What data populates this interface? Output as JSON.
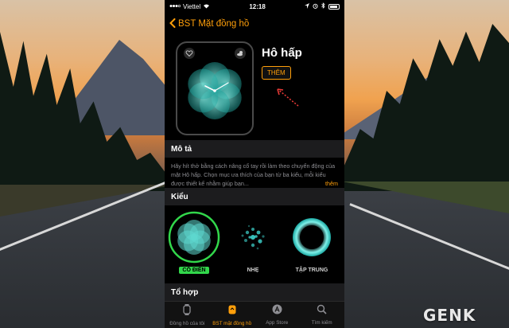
{
  "status": {
    "carrier": "Viettel",
    "time": "12:18"
  },
  "nav": {
    "back_label": "BST Mặt đồng hồ"
  },
  "face": {
    "title": "Hô hấp",
    "add_label": "THÊM"
  },
  "description": {
    "heading": "Mô tả",
    "text": "Hãy hít thở bằng cách nâng cổ tay rồi làm theo chuyển động của mặt Hô hấp. Chọn mục ưa thích của bạn từ ba kiểu, mỗi kiểu được thiết kế nhằm giúp bạn...",
    "more_label": "thêm"
  },
  "styles": {
    "heading": "Kiểu",
    "options": [
      {
        "label": "CỔ ĐIỂN",
        "selected": true
      },
      {
        "label": "NHẸ",
        "selected": false
      },
      {
        "label": "TẬP TRUNG",
        "selected": false
      }
    ]
  },
  "composition": {
    "heading": "Tổ hợp"
  },
  "tabs": [
    {
      "label": "Đồng hồ của tôi",
      "icon": "watch-icon",
      "active": false
    },
    {
      "label": "BST mặt đồng hồ",
      "icon": "face-gallery-icon",
      "active": true
    },
    {
      "label": "App Store",
      "icon": "app-store-icon",
      "active": false
    },
    {
      "label": "Tìm kiếm",
      "icon": "search-icon",
      "active": false
    }
  ],
  "watermark": {
    "logo": "GENK"
  },
  "colors": {
    "accent": "#ff9f0a",
    "selected": "#32d74b"
  }
}
